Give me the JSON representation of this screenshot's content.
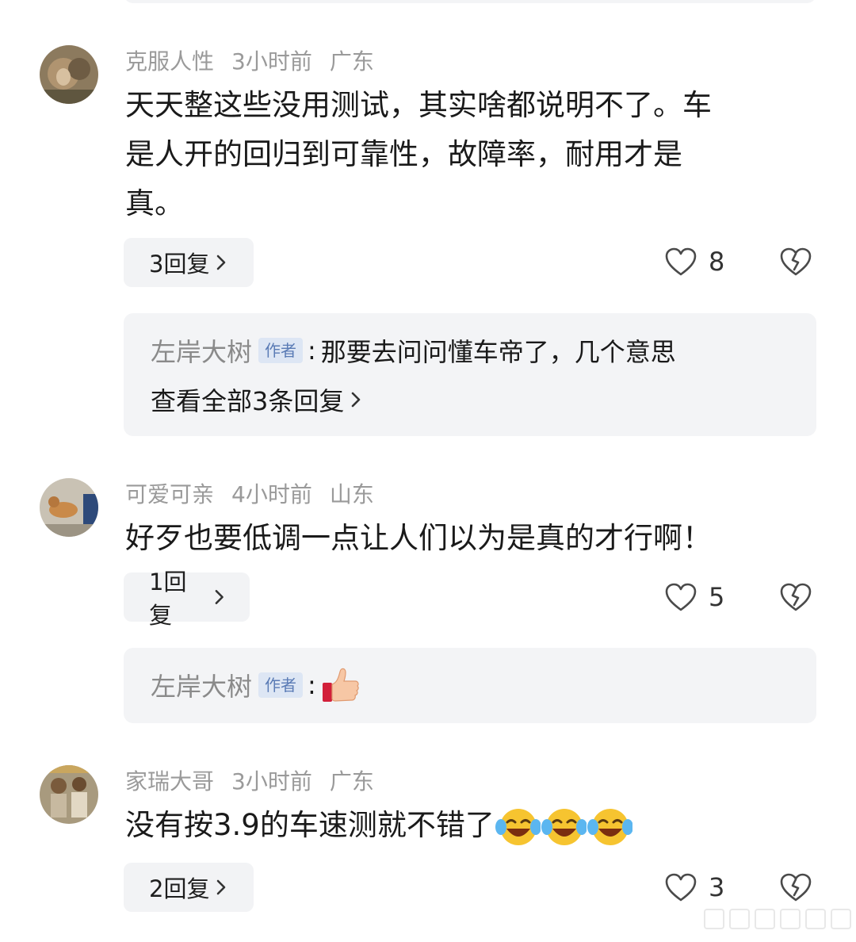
{
  "comments": [
    {
      "username": "克服人性",
      "time": "3小时前",
      "location": "广东",
      "lines": [
        "天天整这些没用测试，其实啥都说明不了。车",
        "是人开的回归到可靠性，故障率，耐用才是",
        "真。"
      ],
      "reply_button": "3回复",
      "likes": "8",
      "author_reply": {
        "name": "左岸大树",
        "badge": "作者",
        "colon": ":",
        "text": "那要去问问懂车帝了，几个意思",
        "view_all": "查看全部3条回复"
      }
    },
    {
      "username": "可爱可亲",
      "time": "4小时前",
      "location": "山东",
      "lines": [
        "好歹也要低调一点让人们以为是真的才行啊！"
      ],
      "reply_button": "1回复",
      "likes": "5",
      "author_reply": {
        "name": "左岸大树",
        "badge": "作者",
        "colon": ":",
        "emoji": "thumbs-up-icon"
      }
    },
    {
      "username": "家瑞大哥",
      "time": "3小时前",
      "location": "广东",
      "text": "没有按3.9的车速测就不错了",
      "emojis": [
        "laughing-crying-icon",
        "laughing-crying-icon",
        "laughing-crying-icon"
      ],
      "reply_button": "2回复",
      "likes": "3"
    }
  ],
  "icons": {
    "like": "heart-outline-icon",
    "dislike": "broken-heart-icon",
    "chevron": "chevron-right-icon"
  },
  "colors": {
    "meta_gray": "#9a9a9a",
    "card_bg": "#f3f4f6",
    "badge_blue": "#5a7bb5",
    "badge_bg": "#dde6f4"
  }
}
